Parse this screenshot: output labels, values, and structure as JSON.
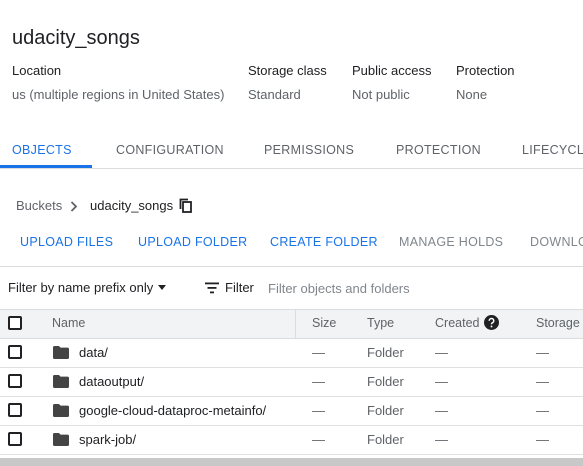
{
  "bucket": {
    "name": "udacity_songs",
    "info": [
      {
        "label": "Location",
        "value": "us (multiple regions in United States)"
      },
      {
        "label": "Storage class",
        "value": "Standard"
      },
      {
        "label": "Public access",
        "value": "Not public"
      },
      {
        "label": "Protection",
        "value": "None"
      }
    ]
  },
  "tabs": [
    "OBJECTS",
    "CONFIGURATION",
    "PERMISSIONS",
    "PROTECTION",
    "LIFECYCLE"
  ],
  "active_tab": "OBJECTS",
  "breadcrumb": {
    "root": "Buckets",
    "current": "udacity_songs"
  },
  "actions": [
    "UPLOAD FILES",
    "UPLOAD FOLDER",
    "CREATE FOLDER",
    "MANAGE HOLDS",
    "DOWNLOAD"
  ],
  "filter": {
    "mode": "Filter by name prefix only",
    "label": "Filter",
    "placeholder": "Filter objects and folders"
  },
  "table": {
    "columns": [
      "Name",
      "Size",
      "Type",
      "Created",
      "Storage class"
    ],
    "rows": [
      {
        "name": "data/",
        "size": "—",
        "type": "Folder",
        "created": "—",
        "storage": "—"
      },
      {
        "name": "dataoutput/",
        "size": "—",
        "type": "Folder",
        "created": "—",
        "storage": "—"
      },
      {
        "name": "google-cloud-dataproc-metainfo/",
        "size": "—",
        "type": "Folder",
        "created": "—",
        "storage": "—"
      },
      {
        "name": "spark-job/",
        "size": "—",
        "type": "Folder",
        "created": "—",
        "storage": "—"
      }
    ]
  },
  "colors": {
    "accent": "#1a73e8",
    "header_bg": "#f1f3f4",
    "divider": "#dadce0"
  },
  "icons": [
    "copy-icon",
    "chevron-right-icon",
    "dropdown-arrow-icon",
    "filter-icon",
    "help-icon",
    "folder-icon"
  ]
}
